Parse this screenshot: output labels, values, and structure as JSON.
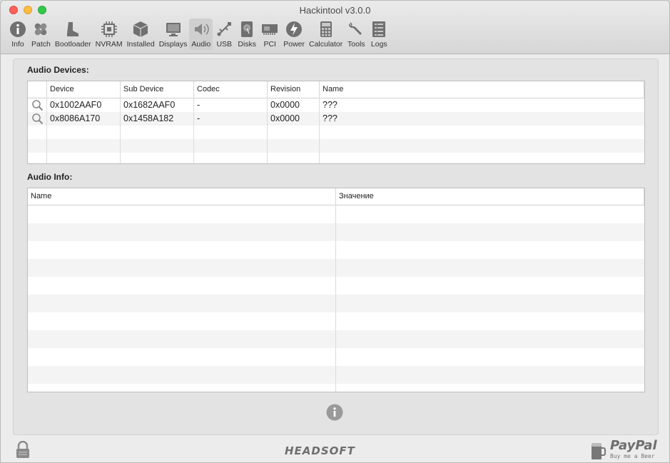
{
  "window": {
    "title": "Hackintool v3.0.0"
  },
  "toolbar": {
    "items": [
      {
        "label": "Info",
        "icon": "info-icon"
      },
      {
        "label": "Patch",
        "icon": "patch-icon"
      },
      {
        "label": "Bootloader",
        "icon": "boot-icon"
      },
      {
        "label": "NVRAM",
        "icon": "chip-icon"
      },
      {
        "label": "Installed",
        "icon": "package-icon"
      },
      {
        "label": "Displays",
        "icon": "display-icon"
      },
      {
        "label": "Audio",
        "icon": "speaker-icon",
        "selected": true
      },
      {
        "label": "USB",
        "icon": "usb-icon"
      },
      {
        "label": "Disks",
        "icon": "disk-icon"
      },
      {
        "label": "PCI",
        "icon": "pci-card-icon"
      },
      {
        "label": "Power",
        "icon": "power-icon"
      },
      {
        "label": "Calculator",
        "icon": "calculator-icon"
      },
      {
        "label": "Tools",
        "icon": "wrench-icon"
      },
      {
        "label": "Logs",
        "icon": "logs-icon"
      }
    ]
  },
  "audio_devices": {
    "title": "Audio Devices:",
    "columns": [
      "Device",
      "Sub Device",
      "Codec",
      "Revision",
      "Name"
    ],
    "rows": [
      {
        "device": "0x1002AAF0",
        "sub_device": "0x1682AAF0",
        "codec": "-",
        "revision": "0x0000",
        "name": "???"
      },
      {
        "device": "0x8086A170",
        "sub_device": "0x1458A182",
        "codec": "-",
        "revision": "0x0000",
        "name": "???"
      }
    ]
  },
  "audio_info": {
    "title": "Audio Info:",
    "columns": [
      "Name",
      "Значение"
    ]
  },
  "footer": {
    "brand": "HEADSOFT",
    "paypal": "PayPal",
    "paypal_sub": "Buy me a Beer"
  },
  "colors": {
    "selected_tab": "#cfcfcf",
    "close": "#fc605b",
    "minimize": "#fdbc40",
    "maximize": "#34c84a"
  }
}
